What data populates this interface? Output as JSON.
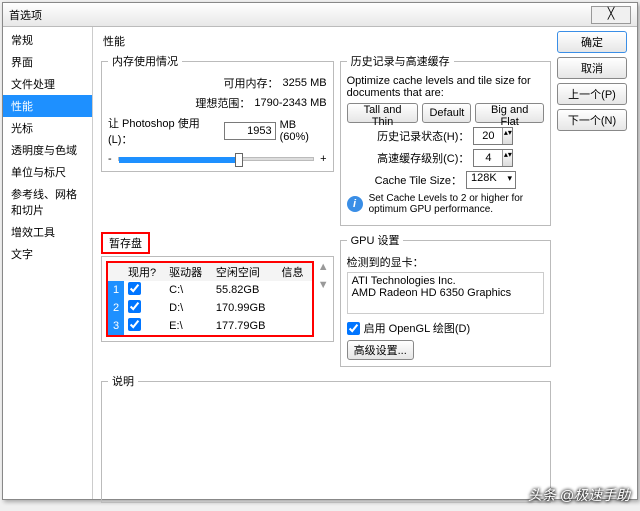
{
  "titlebar": {
    "title": "首选项",
    "close": "╳"
  },
  "sidebar": {
    "items": [
      {
        "label": "常规"
      },
      {
        "label": "界面"
      },
      {
        "label": "文件处理"
      },
      {
        "label": "性能"
      },
      {
        "label": "光标"
      },
      {
        "label": "透明度与色域"
      },
      {
        "label": "单位与标尺"
      },
      {
        "label": "参考线、网格和切片"
      },
      {
        "label": "增效工具"
      },
      {
        "label": "文字"
      }
    ]
  },
  "panel_title": "性能",
  "memory": {
    "legend": "内存使用情况",
    "avail_label": "可用内存：",
    "avail_value": "3255 MB",
    "ideal_label": "理想范围：",
    "ideal_value": "1790-2343 MB",
    "ps_label": "让 Photoshop 使用(L)：",
    "ps_value": "1953",
    "ps_unit": "MB (60%)",
    "minus": "-",
    "plus": "+"
  },
  "history": {
    "legend": "历史记录与高速缓存",
    "desc": "Optimize cache levels and tile size for documents that are:",
    "btn_tall": "Tall and Thin",
    "btn_default": "Default",
    "btn_big": "Big and Flat",
    "states_label": "历史记录状态(H)：",
    "states_value": "20",
    "levels_label": "高速缓存级别(C)：",
    "levels_value": "4",
    "tile_label": "Cache Tile Size：",
    "tile_value": "128K",
    "hint": "Set Cache Levels to 2 or higher for optimum GPU performance."
  },
  "scratch": {
    "legend": "暂存盘",
    "headers": {
      "active": "现用?",
      "drive": "驱动器",
      "free": "空闲空间",
      "info": "信息"
    },
    "disks": [
      {
        "n": "1",
        "drive": "C:\\",
        "free": "55.82GB"
      },
      {
        "n": "2",
        "drive": "D:\\",
        "free": "170.99GB"
      },
      {
        "n": "3",
        "drive": "E:\\",
        "free": "177.79GB"
      }
    ]
  },
  "gpu": {
    "legend": "GPU 设置",
    "detected_label": "检测到的显卡：",
    "vendor": "ATI Technologies Inc.",
    "card": "AMD Radeon HD 6350 Graphics",
    "opengl_label": "启用 OpenGL 绘图(D)",
    "advanced": "高级设置..."
  },
  "desc_panel": {
    "legend": "说明"
  },
  "buttons": {
    "ok": "确定",
    "cancel": "取消",
    "prev": "上一个(P)",
    "next": "下一个(N)"
  },
  "watermark": "头条 @极速手助"
}
